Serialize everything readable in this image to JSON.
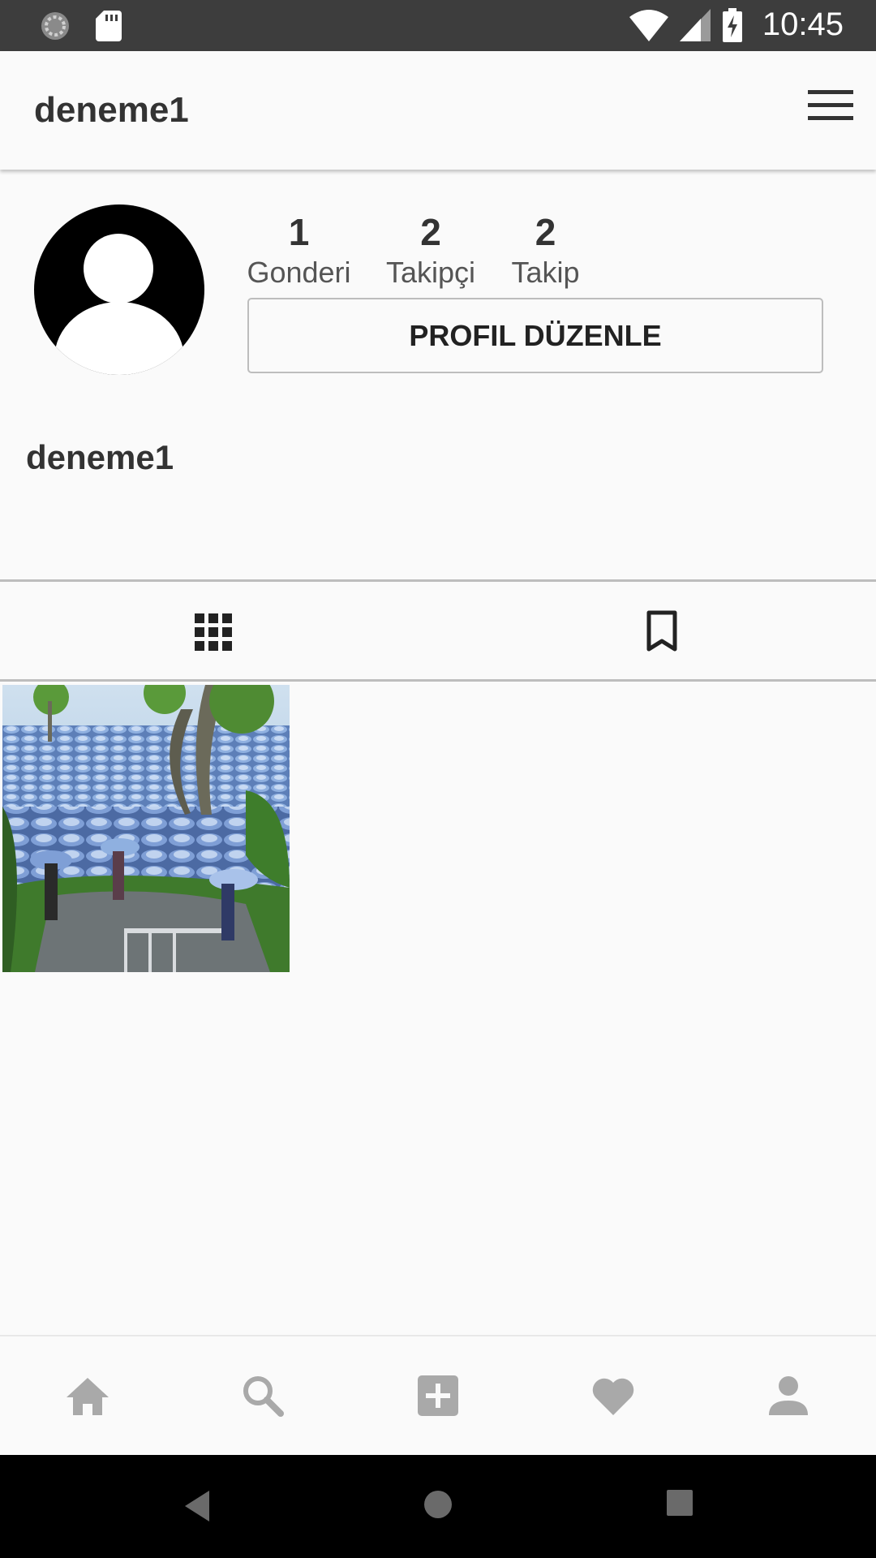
{
  "status_bar": {
    "time": "10:45",
    "icons": [
      "sync-icon",
      "sd-card-icon",
      "wifi-icon",
      "signal-icon",
      "battery-charging-icon"
    ]
  },
  "toolbar": {
    "title": "deneme1",
    "menu_icon": "hamburger-menu-icon"
  },
  "profile": {
    "avatar_icon": "default-avatar-icon",
    "stats": {
      "posts": {
        "count": "1",
        "label": "Gonderi"
      },
      "followers": {
        "count": "2",
        "label": "Takipçi"
      },
      "following": {
        "count": "2",
        "label": "Takip"
      }
    },
    "edit_button_label": "PROFIL DÜZENLE",
    "display_name": "deneme1"
  },
  "tabs": [
    {
      "icon": "grid-icon",
      "selected": true
    },
    {
      "icon": "bookmark-icon",
      "selected": false
    }
  ],
  "posts": [
    {
      "kind": "painting of people with blue umbrellas in a park"
    }
  ],
  "bottom_nav": [
    {
      "icon": "home-icon"
    },
    {
      "icon": "search-icon"
    },
    {
      "icon": "add-box-icon"
    },
    {
      "icon": "heart-icon"
    },
    {
      "icon": "person-icon"
    }
  ],
  "colors": {
    "status_bar": "#3d3d3d",
    "background": "#fafafa",
    "text_dark": "#333333",
    "nav_icon": "#a9a9a9",
    "system_nav": "#000000"
  }
}
